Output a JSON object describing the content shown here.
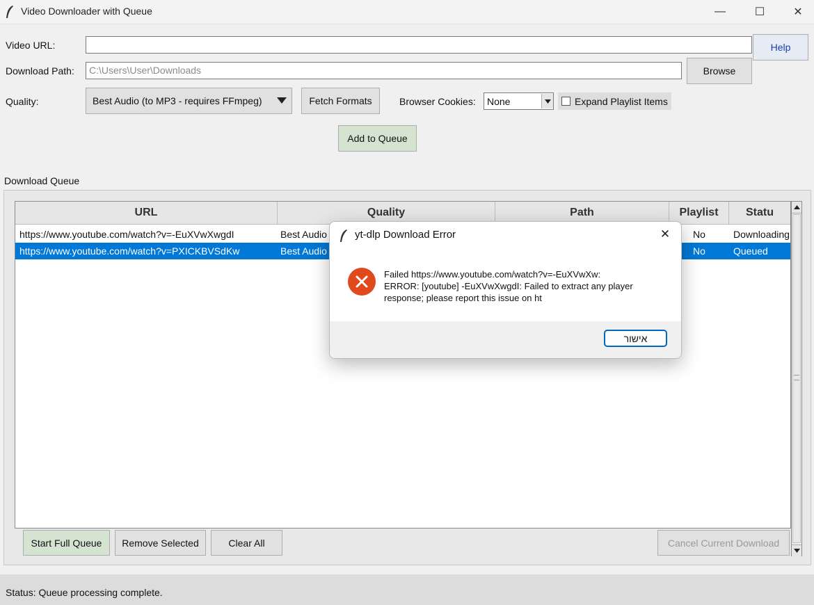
{
  "window": {
    "title": "Video Downloader with Queue",
    "minimize": "—",
    "maximize": "☐",
    "close": "✕"
  },
  "form": {
    "url_label": "Video URL:",
    "url_value": "",
    "help_label": "Help",
    "path_label": "Download Path:",
    "path_placeholder": "C:\\Users\\User\\Downloads",
    "browse_label": "Browse",
    "quality_label": "Quality:",
    "quality_value": "Best Audio (to MP3 - requires FFmpeg)",
    "fetch_formats_label": "Fetch Formats",
    "cookies_label": "Browser Cookies:",
    "cookies_value": "None",
    "expand_playlist_label": "Expand Playlist Items",
    "expand_playlist_checked": false,
    "add_queue_label": "Add to Queue"
  },
  "queue": {
    "frame_label": "Download Queue",
    "columns": [
      "URL",
      "Quality",
      "Path",
      "Playlist",
      "Statu"
    ],
    "rows": [
      {
        "url": "https://www.youtube.com/watch?v=-EuXVwXwgdI",
        "quality": "Best Audio",
        "path": "",
        "playlist": "No",
        "status": "Downloading",
        "selected": false
      },
      {
        "url": "https://www.youtube.com/watch?v=PXICKBVSdKw",
        "quality": "Best Audio",
        "path": "",
        "playlist": "No",
        "status": "Queued",
        "selected": true
      }
    ]
  },
  "buttons": {
    "start_full_queue": "Start Full Queue",
    "remove_selected": "Remove Selected",
    "clear_all": "Clear All",
    "cancel_current": "Cancel Current Download"
  },
  "status": {
    "text": "Status: Queue processing complete."
  },
  "dialog": {
    "title": "yt-dlp Download Error",
    "close": "✕",
    "message_lines": [
      "Failed https://www.youtube.com/watch?v=-EuXVwXw:",
      "ERROR: [youtube] -EuXVwXwgdI: Failed to extract any player",
      "response; please report this issue on  ht"
    ],
    "ok_label": "אישור"
  },
  "colors": {
    "selection": "#0078d7",
    "error_icon": "#e0481e",
    "green_button": "#d4e4d1"
  }
}
